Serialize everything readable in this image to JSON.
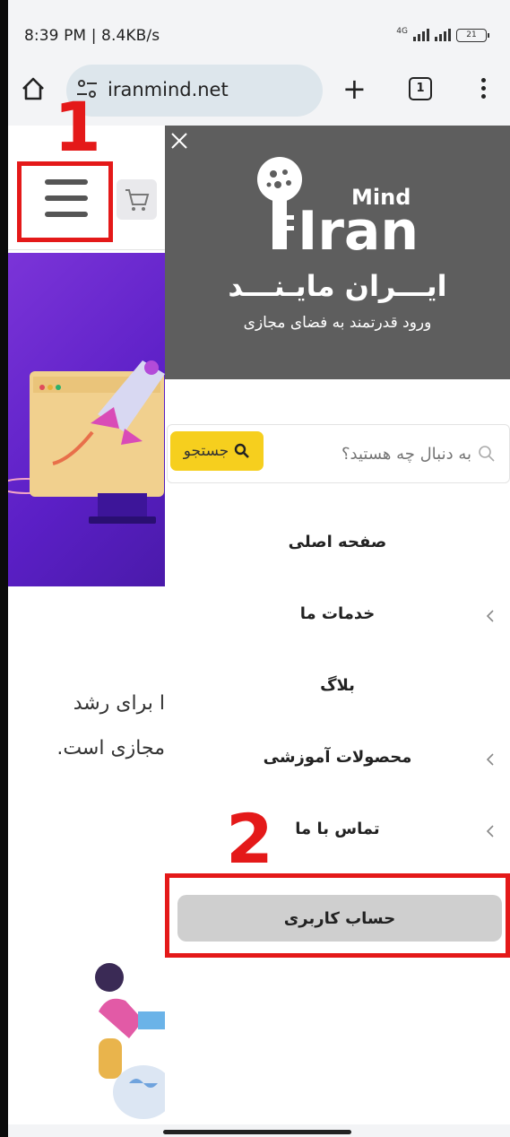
{
  "status_bar": {
    "time": "8:39 PM | 8.4KB/s",
    "network": "4G",
    "battery": "21"
  },
  "browser": {
    "url": "iranmind.net",
    "tab_count": "1"
  },
  "annotations": {
    "step_1": "1",
    "step_2": "2",
    "highlight_color": "#e41919"
  },
  "page": {
    "body_line_1": "ا برای رشد",
    "body_line_2": "مجازی است."
  },
  "drawer": {
    "brand_en_small": "Mind",
    "brand_en_large": "Iran",
    "brand_fa": "ایـــران مایـنـــد",
    "tagline": "ورود قدرتمند به فضای مجازی",
    "search": {
      "placeholder": "به دنبال چه هستید؟",
      "button_label": "جستجو"
    },
    "nav": [
      {
        "label": "صفحه اصلی",
        "has_submenu": false
      },
      {
        "label": "خدمات ما",
        "has_submenu": true
      },
      {
        "label": "بلاگ",
        "has_submenu": false
      },
      {
        "label": "محصولات آموزشی",
        "has_submenu": true
      },
      {
        "label": "تماس با ما",
        "has_submenu": true
      }
    ],
    "account_button": "حساب کاربری"
  },
  "colors": {
    "search_button": "#f6cf1e",
    "drawer_header": "#5e5e5e",
    "hero": "#6a2bd0"
  }
}
